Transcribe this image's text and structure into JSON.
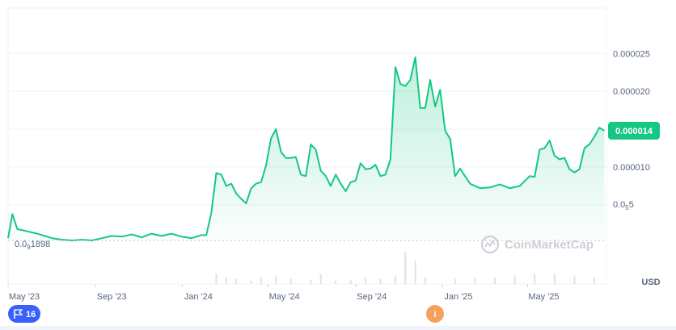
{
  "chart_data": {
    "type": "area",
    "yticks": [
      {
        "value": 2.5e-05,
        "label": "0.000025"
      },
      {
        "value": 2e-05,
        "label": "0.000020"
      },
      {
        "value": 1e-05,
        "label": "0.000010"
      }
    ],
    "ytick_subscript": {
      "value": 5e-06,
      "prefix": "0.0",
      "sub": "5",
      "suffix": "5"
    },
    "ylim": [
      3e-07,
      3.1e-05
    ],
    "xticks": [
      {
        "date": "2023-05-01",
        "label": "May '23"
      },
      {
        "date": "2023-09-01",
        "label": "Sep '23"
      },
      {
        "date": "2024-01-01",
        "label": "Jan '24"
      },
      {
        "date": "2024-05-01",
        "label": "May '24"
      },
      {
        "date": "2024-09-01",
        "label": "Sep '24"
      },
      {
        "date": "2025-01-01",
        "label": "Jan '25"
      },
      {
        "date": "2025-05-01",
        "label": "May '25"
      }
    ],
    "xlim": [
      "2023-05-01",
      "2025-08-20"
    ],
    "start_value": {
      "prefix": "0.0",
      "sub": "9",
      "suffix": "1898",
      "value": 1.898e-09
    },
    "current_value_label": "0.000014",
    "unit": "USD",
    "grid": true,
    "colors": {
      "line": "#16c784",
      "fill": "#16c784",
      "volume": "#dfe2e8",
      "grid": "#eff2f5"
    },
    "series": [
      {
        "x": [
          "2023-05-01",
          "2023-05-07",
          "2023-05-14",
          "2023-05-28",
          "2023-06-11",
          "2023-06-25",
          "2023-07-02",
          "2023-07-16",
          "2023-07-30",
          "2023-08-13",
          "2023-08-27",
          "2023-09-10",
          "2023-09-24",
          "2023-10-08",
          "2023-10-22",
          "2023-11-05",
          "2023-11-19",
          "2023-12-03",
          "2023-12-17",
          "2023-12-31",
          "2024-01-14",
          "2024-01-28",
          "2024-02-04",
          "2024-02-11",
          "2024-02-18",
          "2024-02-25",
          "2024-03-03",
          "2024-03-10",
          "2024-03-17",
          "2024-03-24",
          "2024-03-31",
          "2024-04-07",
          "2024-04-14",
          "2024-04-21",
          "2024-04-28",
          "2024-05-05",
          "2024-05-12",
          "2024-05-19",
          "2024-05-26",
          "2024-06-02",
          "2024-06-09",
          "2024-06-16",
          "2024-06-23",
          "2024-06-30",
          "2024-07-07",
          "2024-07-14",
          "2024-07-21",
          "2024-07-28",
          "2024-08-04",
          "2024-08-11",
          "2024-08-18",
          "2024-08-25",
          "2024-09-01",
          "2024-09-08",
          "2024-09-15",
          "2024-09-22",
          "2024-09-29",
          "2024-10-06",
          "2024-10-13",
          "2024-10-20",
          "2024-10-27",
          "2024-11-03",
          "2024-11-10",
          "2024-11-17",
          "2024-11-24",
          "2024-12-01",
          "2024-12-08",
          "2024-12-15",
          "2024-12-22",
          "2024-12-29",
          "2025-01-05",
          "2025-01-12",
          "2025-01-19",
          "2025-01-26",
          "2025-02-02",
          "2025-02-09",
          "2025-02-23",
          "2025-03-09",
          "2025-03-23",
          "2025-04-06",
          "2025-04-20",
          "2025-05-04",
          "2025-05-11",
          "2025-05-18",
          "2025-05-25",
          "2025-06-01",
          "2025-06-08",
          "2025-06-15",
          "2025-06-22",
          "2025-06-29",
          "2025-07-06",
          "2025-07-13",
          "2025-07-20",
          "2025-07-27",
          "2025-08-03",
          "2025-08-10",
          "2025-08-17"
        ],
        "values": [
          6e-07,
          3.8e-06,
          1.8e-06,
          1.5e-06,
          1.2e-06,
          8e-07,
          6e-07,
          4e-07,
          3e-07,
          4e-07,
          3e-07,
          6e-07,
          9e-07,
          8e-07,
          1.1e-06,
          7e-07,
          1.2e-06,
          9e-07,
          1.2e-06,
          8e-07,
          6e-07,
          1e-06,
          1e-06,
          4e-06,
          9.2e-06,
          9e-06,
          7.5e-06,
          7.8e-06,
          6.5e-06,
          5.8e-06,
          5.2e-06,
          7.2e-06,
          7.8e-06,
          8e-06,
          1.02e-05,
          1.38e-05,
          1.5e-05,
          1.2e-05,
          1.12e-05,
          1.12e-05,
          1.13e-05,
          9e-06,
          8.8e-06,
          1.3e-05,
          1.23e-05,
          9.5e-06,
          8.8e-06,
          7.5e-06,
          9e-06,
          7.8e-06,
          6.8e-06,
          8e-06,
          8.2e-06,
          1.05e-05,
          9.7e-06,
          9.8e-06,
          1.03e-05,
          8.8e-06,
          9e-06,
          1.1e-05,
          2.32e-05,
          2.1e-05,
          2.07e-05,
          2.15e-05,
          2.45e-05,
          1.78e-05,
          1.78e-05,
          2.15e-05,
          1.8e-05,
          2.02e-05,
          1.48e-05,
          1.37e-05,
          8.8e-06,
          9.8e-06,
          8.8e-06,
          7.8e-06,
          7.2e-06,
          7.3e-06,
          7.7e-06,
          7.2e-06,
          7.5e-06,
          8.8e-06,
          8.7e-06,
          1.23e-05,
          1.25e-05,
          1.35e-05,
          1.15e-05,
          1.1e-05,
          1.12e-05,
          9.7e-06,
          9.3e-06,
          9.7e-06,
          1.25e-05,
          1.3e-05,
          1.4e-05,
          1.52e-05,
          1.48e-05
        ]
      }
    ],
    "volume": {
      "x": [
        "2024-02-18",
        "2024-03-03",
        "2024-03-17",
        "2024-04-07",
        "2024-04-21",
        "2024-05-12",
        "2024-06-02",
        "2024-06-30",
        "2024-07-14",
        "2024-08-04",
        "2024-08-25",
        "2024-09-15",
        "2024-10-06",
        "2024-10-27",
        "2024-11-10",
        "2024-11-24",
        "2024-12-08",
        "2025-01-19",
        "2025-02-16",
        "2025-03-16",
        "2025-04-13",
        "2025-05-11",
        "2025-06-08",
        "2025-07-06",
        "2025-08-03"
      ],
      "values": [
        0.3,
        0.2,
        0.15,
        0.1,
        0.2,
        0.25,
        0.15,
        0.12,
        0.3,
        0.1,
        0.12,
        0.2,
        0.15,
        0.25,
        0.95,
        0.7,
        0.2,
        0.15,
        0.18,
        0.2,
        0.25,
        0.3,
        0.3,
        0.25,
        0.2
      ]
    }
  },
  "watermark": "CoinMarketCap",
  "events": {
    "flag_label": "16",
    "info_label": "i"
  },
  "icons": {
    "flag": "flag-icon",
    "info": "info-icon",
    "logo": "coinmarketcap-logo-icon"
  }
}
